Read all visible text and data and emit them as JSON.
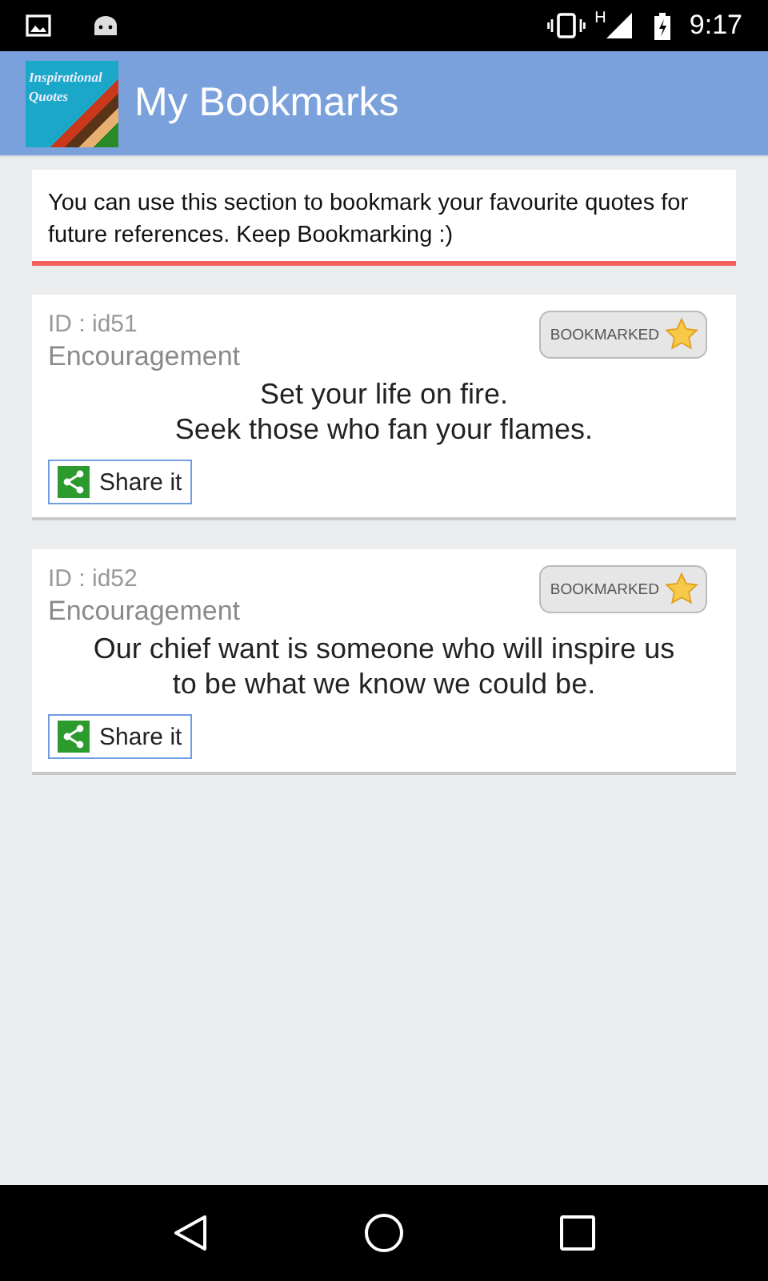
{
  "status_bar": {
    "network": "H",
    "time": "9:17"
  },
  "app_bar": {
    "logo_lines": [
      "Inspirational",
      "Quotes"
    ],
    "title": "My Bookmarks"
  },
  "intro": "You can use this section to bookmark your favourite quotes for future references. Keep Bookmarking :)",
  "quotes": [
    {
      "id": "ID : id51",
      "category": "Encouragement",
      "text": [
        "Set your life on fire.",
        "Seek those who fan your flames."
      ],
      "bookmark": "BOOKMARKED",
      "bookmarked": true,
      "share": "Share it"
    },
    {
      "id": "ID : id52",
      "category": "Encouragement",
      "text": [
        "Our chief want is someone who will inspire us",
        "to be what we know we could be."
      ],
      "bookmark": "BOOKMARKED",
      "bookmarked": true,
      "share": "Share it"
    }
  ]
}
